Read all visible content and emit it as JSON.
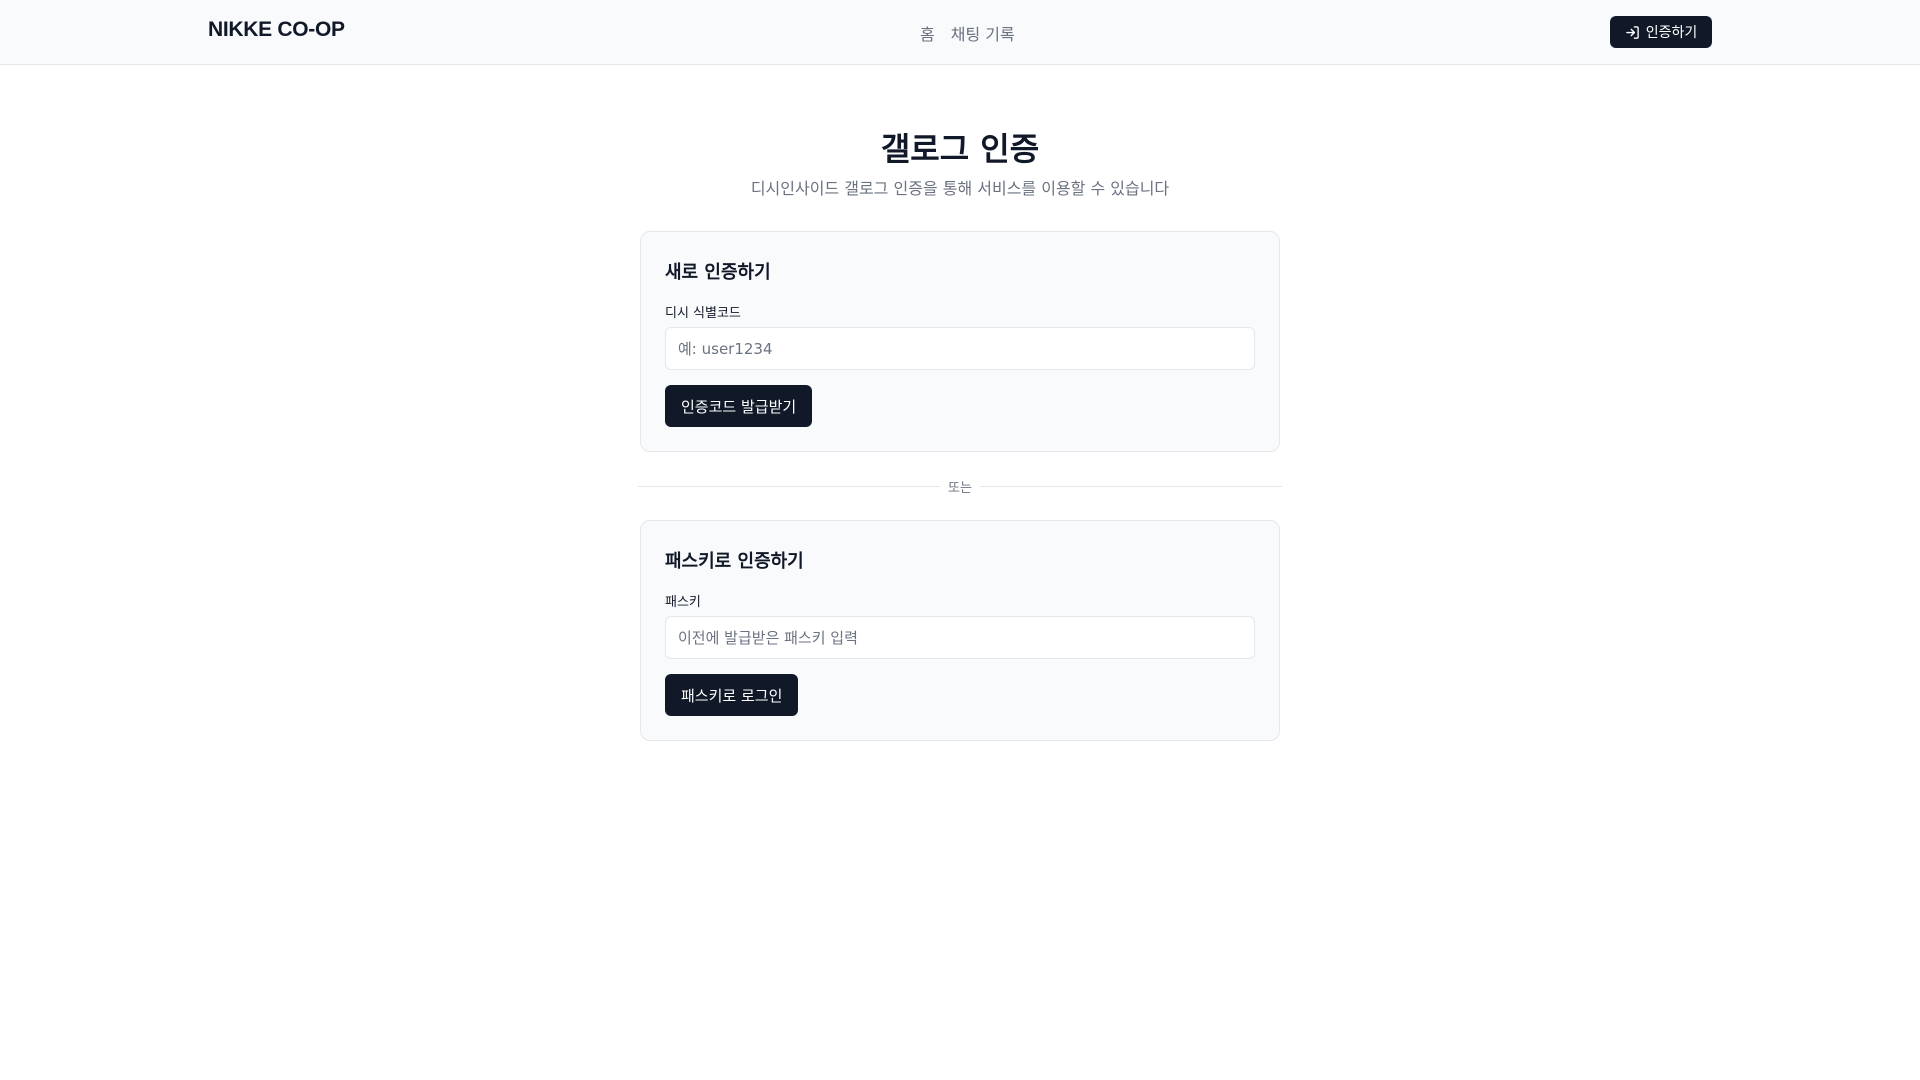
{
  "header": {
    "brand": "NIKKE CO-OP",
    "nav": [
      {
        "label": "홈"
      },
      {
        "label": "채팅 기록"
      }
    ],
    "login_button": {
      "label": "인증하기",
      "icon": "login-icon"
    }
  },
  "page": {
    "title": "갤로그 인증",
    "subtitle": "디시인사이드 갤로그 인증을 통해 서비스를 이용할 수 있습니다"
  },
  "new_auth": {
    "title": "새로 인증하기",
    "field_label": "디시 식별코드",
    "placeholder": "예: user1234",
    "value": "",
    "button_label": "인증코드 발급받기"
  },
  "divider": {
    "label": "또는"
  },
  "passkey_auth": {
    "title": "패스키로 인증하기",
    "field_label": "패스키",
    "placeholder": "이전에 발급받은 패스키 입력",
    "value": "",
    "button_label": "패스키로 로그인"
  },
  "colors": {
    "primary": "#111827",
    "muted_text": "#6b7280",
    "header_bg": "#f8fafc",
    "card_bg": "#f8fafc",
    "border": "#e5e7eb"
  }
}
